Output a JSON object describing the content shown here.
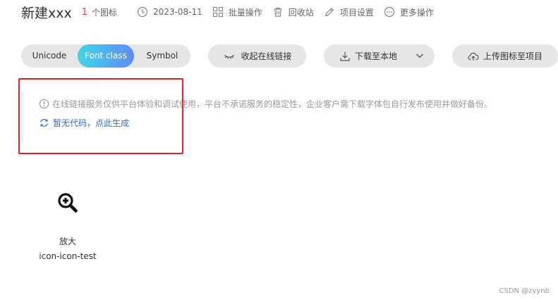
{
  "header": {
    "title": "新建xxx",
    "icon_count_num": "1",
    "icon_count_text": "个图标",
    "date": "2023-08-11",
    "batch_ops": "批量操作",
    "recycle": "回收站",
    "settings": "项目设置",
    "more": "更多操作"
  },
  "toolbar": {
    "tabs": [
      {
        "label": "Unicode"
      },
      {
        "label": "Font class",
        "active": true
      },
      {
        "label": "Symbol"
      }
    ],
    "collapse_label": "收起在线链接",
    "download_label": "下载至本地",
    "upload_label": "上传图标至项目"
  },
  "notice": {
    "text": "在线链接服务仅供平台体验和调试使用，平台不承诺服务的稳定性，企业客户需下载字体包自行发布使用并做好备份。",
    "link": "暂无代码，点此生成"
  },
  "icons": [
    {
      "name": "放大",
      "code": "icon-icon-test",
      "icon": "zoom-in-icon"
    }
  ],
  "watermark": "CSDN @zyynb",
  "colors": {
    "active_tab_start": "#3fd6e6",
    "active_tab_end": "#5f8cf7",
    "link": "#2a6bd4",
    "count_red": "#e4393c",
    "highlight_box": "#e52222"
  }
}
